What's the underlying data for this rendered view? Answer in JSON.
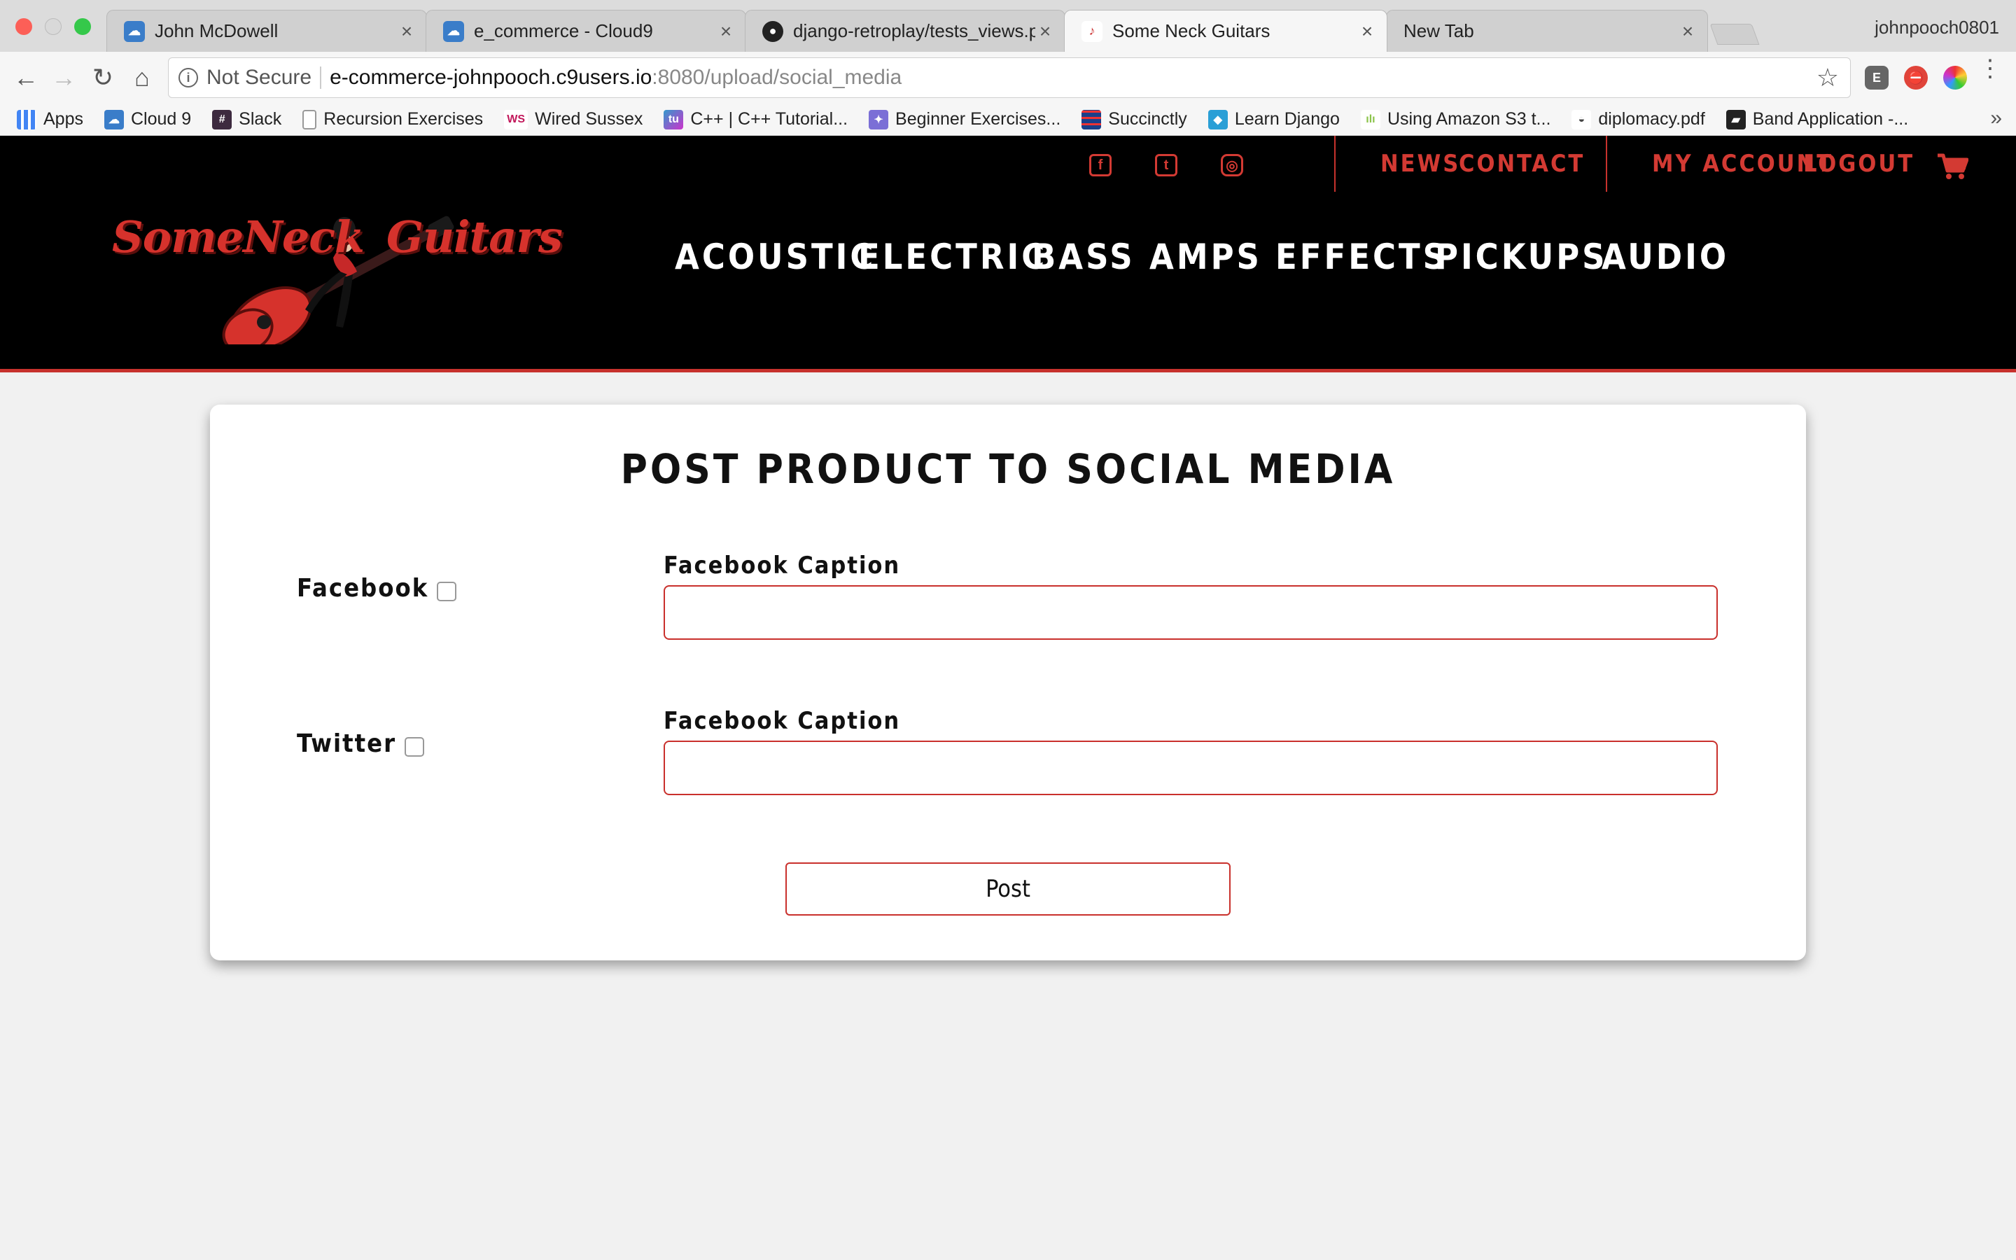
{
  "browser": {
    "tabs": [
      {
        "title": "John McDowell",
        "favicon": "cloud9-icon",
        "active": false
      },
      {
        "title": "e_commerce - Cloud9",
        "favicon": "cloud9-icon",
        "active": false
      },
      {
        "title": "django-retroplay/tests_views.p",
        "favicon": "github-icon",
        "active": false
      },
      {
        "title": "Some Neck Guitars",
        "favicon": "guitar-icon",
        "active": true
      },
      {
        "title": "New Tab",
        "favicon": "",
        "active": false
      }
    ],
    "profile_name": "johnpooch0801",
    "address": {
      "security_label": "Not Secure",
      "host": "e-commerce-johnpooch.c9users.io",
      "path": ":8080/upload/social_media"
    },
    "bookmarks": [
      {
        "label": "Apps",
        "icon": "apps-grid-icon"
      },
      {
        "label": "Cloud 9",
        "icon": "cloud9-icon"
      },
      {
        "label": "Slack",
        "icon": "slack-icon"
      },
      {
        "label": "Recursion Exercises",
        "icon": "page-icon"
      },
      {
        "label": "Wired Sussex",
        "icon": "ws-icon"
      },
      {
        "label": "C++ | C++ Tutorial...",
        "icon": "cpp-icon"
      },
      {
        "label": "Beginner Exercises...",
        "icon": "exercises-icon"
      },
      {
        "label": "Succinctly",
        "icon": "succinctly-icon"
      },
      {
        "label": "Learn Django",
        "icon": "django-icon"
      },
      {
        "label": "Using Amazon S3 t...",
        "icon": "s3-icon"
      },
      {
        "label": "diplomacy.pdf",
        "icon": "pdf-icon"
      },
      {
        "label": "Band Application -...",
        "icon": "band-icon"
      }
    ],
    "bookmarks_overflow": "»"
  },
  "site": {
    "logo_text_left": "SomeNeck",
    "logo_text_right": "Guitars",
    "utility_nav": {
      "news": "NEWS",
      "contact": "CONTACT",
      "my_account": "MY ACCOUNT",
      "logout": "LOGOUT"
    },
    "main_nav": [
      "ACOUSTIC",
      "ELECTRIC",
      "BASS",
      "AMPS",
      "EFFECTS",
      "PICKUPS",
      "AUDIO"
    ],
    "colors": {
      "accent": "#d33a33",
      "header_bg": "#000000",
      "page_bg": "#f1f1f1"
    }
  },
  "form": {
    "title": "POST PRODUCT TO SOCIAL MEDIA",
    "rows": [
      {
        "platform": "Facebook",
        "checked": false,
        "caption_label": "Facebook Caption",
        "caption_value": ""
      },
      {
        "platform": "Twitter",
        "checked": false,
        "caption_label": "Facebook Caption",
        "caption_value": ""
      }
    ],
    "submit_label": "Post"
  }
}
